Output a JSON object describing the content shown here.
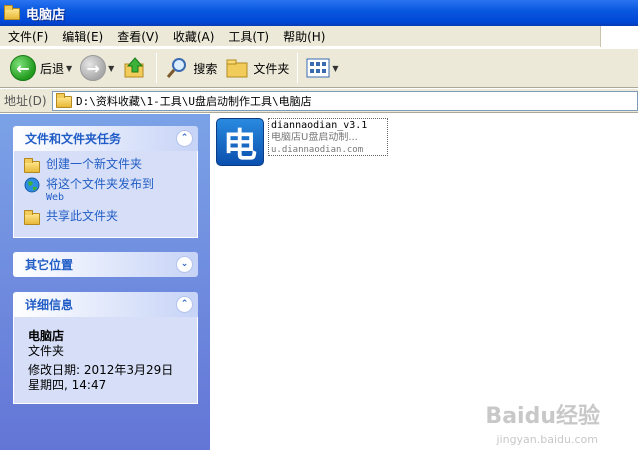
{
  "window": {
    "title": "电脑店"
  },
  "menu": [
    "文件(F)",
    "编辑(E)",
    "查看(V)",
    "收藏(A)",
    "工具(T)",
    "帮助(H)"
  ],
  "toolbar": {
    "back_label": "后退",
    "search_label": "搜索",
    "folders_label": "文件夹"
  },
  "address": {
    "label": "地址(D)",
    "path": "D:\\资料收藏\\1-工具\\U盘启动制作工具\\电脑店"
  },
  "tasks_panel": {
    "title": "文件和文件夹任务",
    "items": [
      {
        "label": "创建一个新文件夹",
        "sub": ""
      },
      {
        "label": "将这个文件夹发布到",
        "sub": "Web"
      },
      {
        "label": "共享此文件夹",
        "sub": ""
      }
    ]
  },
  "other_panel": {
    "title": "其它位置"
  },
  "details_panel": {
    "title": "详细信息",
    "name": "电脑店",
    "type": "文件夹",
    "modified": "修改日期: 2012年3月29日",
    "weekday": "星期四, 14:47"
  },
  "file": {
    "icon_glyph": "电",
    "name": "diannaodian_v3.1",
    "description": "电脑店U盘启动制...",
    "url": "u.diannaodian.com"
  },
  "watermark": {
    "brand": "Baidu经验",
    "url": "jingyan.baidu.com"
  },
  "colors": {
    "title_bar": "#0a58e0",
    "panel_bg": "#d6dff7",
    "link": "#215dc6",
    "left_pane": "#6f8ce0"
  }
}
